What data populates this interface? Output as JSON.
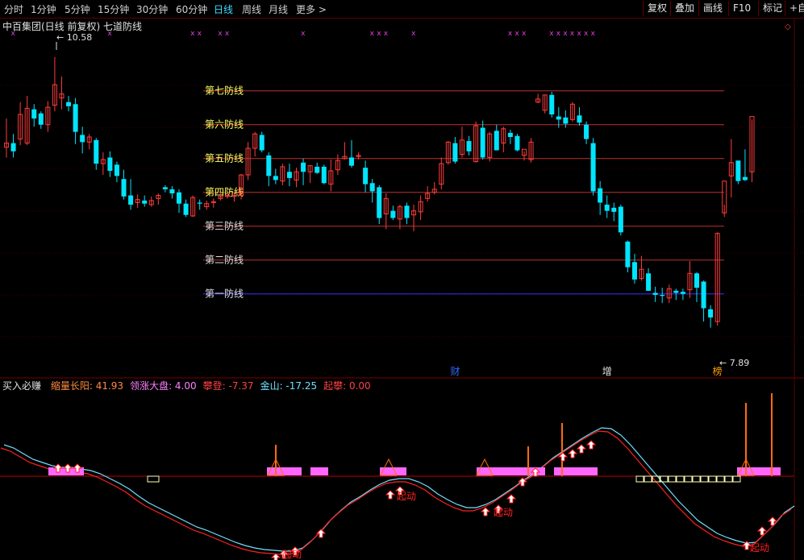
{
  "toolbar": {
    "periods": [
      "分时",
      "1分钟",
      "5分钟",
      "15分钟",
      "30分钟",
      "60分钟",
      "日线",
      "周线",
      "月线",
      "更多 >"
    ],
    "active_period": "日线",
    "right_buttons": [
      "复权",
      "叠加",
      "画线",
      "F10",
      "标记",
      "+自"
    ]
  },
  "main": {
    "title": "中百集团(日线 前复权) 七道防线",
    "high_label": "10.58",
    "low_label": "7.89",
    "defense_lines": [
      {
        "label": "第七防线",
        "price": 10.25
      },
      {
        "label": "第六防线",
        "price": 9.92
      },
      {
        "label": "第五防线",
        "price": 9.59
      },
      {
        "label": "第四防线",
        "price": 9.26
      },
      {
        "label": "第三防线",
        "price": 8.93
      },
      {
        "label": "第二防线",
        "price": 8.6
      },
      {
        "label": "第一防线",
        "price": 8.27
      }
    ],
    "events": [
      {
        "text": "财",
        "index": 65,
        "color": "#2a6cff"
      },
      {
        "text": "增",
        "index": 87,
        "color": "#e0e0e0"
      },
      {
        "text": "榜",
        "index": 103,
        "color": "#ffa000"
      }
    ],
    "colors": {
      "up": "#ff3c3c",
      "down": "#00e5ff",
      "line": "#c03030",
      "first_line": "#3030ff",
      "label": "#ffff60"
    }
  },
  "chart_data": {
    "type": "candlestick",
    "y_range": [
      7.6,
      10.9
    ],
    "candles": [
      [
        9.7,
        9.98,
        9.6,
        9.74
      ],
      [
        9.74,
        9.83,
        9.6,
        9.66
      ],
      [
        9.78,
        10.14,
        9.72,
        10.02
      ],
      [
        9.74,
        10.2,
        9.72,
        10.08
      ],
      [
        10.07,
        10.12,
        9.9,
        9.98
      ],
      [
        10.03,
        10.05,
        9.88,
        9.92
      ],
      [
        9.92,
        10.15,
        9.85,
        10.09
      ],
      [
        10.11,
        10.58,
        10.05,
        10.31
      ],
      [
        10.18,
        10.39,
        10.07,
        10.22
      ],
      [
        10.14,
        10.2,
        10.05,
        10.1
      ],
      [
        10.12,
        10.18,
        9.73,
        9.85
      ],
      [
        9.82,
        9.9,
        9.64,
        9.75
      ],
      [
        9.75,
        9.83,
        9.68,
        9.8
      ],
      [
        9.77,
        9.79,
        9.48,
        9.54
      ],
      [
        9.54,
        9.65,
        9.43,
        9.58
      ],
      [
        9.6,
        9.66,
        9.41,
        9.47
      ],
      [
        9.53,
        9.56,
        9.36,
        9.42
      ],
      [
        9.39,
        9.48,
        9.19,
        9.22
      ],
      [
        9.23,
        9.39,
        9.09,
        9.14
      ],
      [
        9.16,
        9.24,
        9.11,
        9.19
      ],
      [
        9.18,
        9.23,
        9.12,
        9.15
      ],
      [
        9.14,
        9.22,
        9.12,
        9.18
      ],
      [
        9.2,
        9.25,
        9.14,
        9.23
      ],
      [
        9.31,
        9.33,
        9.26,
        9.29
      ],
      [
        9.29,
        9.32,
        9.2,
        9.25
      ],
      [
        9.26,
        9.29,
        9.06,
        9.15
      ],
      [
        9.15,
        9.19,
        9.02,
        9.04
      ],
      [
        9.03,
        9.23,
        9.02,
        9.21
      ],
      [
        9.16,
        9.19,
        9.09,
        9.15
      ],
      [
        9.12,
        9.18,
        9.09,
        9.15
      ],
      [
        9.16,
        9.2,
        9.11,
        9.17
      ],
      [
        9.2,
        9.25,
        9.18,
        9.22
      ],
      [
        9.22,
        9.24,
        9.2,
        9.23
      ],
      [
        9.22,
        9.26,
        9.17,
        9.23
      ],
      [
        9.23,
        9.44,
        9.19,
        9.43
      ],
      [
        9.43,
        9.75,
        9.38,
        9.69
      ],
      [
        9.69,
        9.85,
        9.61,
        9.83
      ],
      [
        9.82,
        9.85,
        9.65,
        9.67
      ],
      [
        9.62,
        9.65,
        9.32,
        9.42
      ],
      [
        9.42,
        9.49,
        9.34,
        9.38
      ],
      [
        9.37,
        9.54,
        9.33,
        9.51
      ],
      [
        9.46,
        9.54,
        9.32,
        9.4
      ],
      [
        9.38,
        9.5,
        9.31,
        9.46
      ],
      [
        9.55,
        9.59,
        9.33,
        9.46
      ],
      [
        9.46,
        9.52,
        9.35,
        9.52
      ],
      [
        9.51,
        9.55,
        9.44,
        9.45
      ],
      [
        9.51,
        9.53,
        9.34,
        9.35
      ],
      [
        9.34,
        9.58,
        9.27,
        9.47
      ],
      [
        9.48,
        9.63,
        9.43,
        9.57
      ],
      [
        9.59,
        9.75,
        9.58,
        9.61
      ],
      [
        9.6,
        9.77,
        9.5,
        9.52
      ],
      [
        9.61,
        9.65,
        9.58,
        9.62
      ],
      [
        9.5,
        9.57,
        9.26,
        9.34
      ],
      [
        9.35,
        9.39,
        9.16,
        9.27
      ],
      [
        9.31,
        9.33,
        8.95,
        9.01
      ],
      [
        9.05,
        9.25,
        8.9,
        9.2
      ],
      [
        9.08,
        9.13,
        8.99,
        9.01
      ],
      [
        9.0,
        9.14,
        8.9,
        9.12
      ],
      [
        9.13,
        9.16,
        8.95,
        9.01
      ],
      [
        9.04,
        9.14,
        8.88,
        9.08
      ],
      [
        9.07,
        9.23,
        8.99,
        9.17
      ],
      [
        9.2,
        9.32,
        9.17,
        9.25
      ],
      [
        9.26,
        9.36,
        9.24,
        9.29
      ],
      [
        9.34,
        9.6,
        9.29,
        9.54
      ],
      [
        9.55,
        9.76,
        9.53,
        9.75
      ],
      [
        9.74,
        9.8,
        9.54,
        9.56
      ],
      [
        9.63,
        9.9,
        9.6,
        9.77
      ],
      [
        9.76,
        9.81,
        9.62,
        9.66
      ],
      [
        9.56,
        9.95,
        9.55,
        9.91
      ],
      [
        9.89,
        9.96,
        9.58,
        9.6
      ],
      [
        9.6,
        9.85,
        9.56,
        9.83
      ],
      [
        9.86,
        9.92,
        9.67,
        9.67
      ],
      [
        9.74,
        9.9,
        9.65,
        9.88
      ],
      [
        9.84,
        9.87,
        9.73,
        9.8
      ],
      [
        9.81,
        9.83,
        9.66,
        9.67
      ],
      [
        9.62,
        9.66,
        9.57,
        9.68
      ],
      [
        9.58,
        9.79,
        9.55,
        9.75
      ],
      [
        10.14,
        10.22,
        10.13,
        10.17
      ],
      [
        10.06,
        10.21,
        10.03,
        10.21
      ],
      [
        10.21,
        10.24,
        9.99,
        10.02
      ],
      [
        10.0,
        10.09,
        9.89,
        9.97
      ],
      [
        9.99,
        10.06,
        9.89,
        9.93
      ],
      [
        9.97,
        10.14,
        9.95,
        10.12
      ],
      [
        10.01,
        10.09,
        9.91,
        9.94
      ],
      [
        9.92,
        9.95,
        9.73,
        9.78
      ],
      [
        9.74,
        9.79,
        9.23,
        9.27
      ],
      [
        9.3,
        9.37,
        9.04,
        9.16
      ],
      [
        9.14,
        9.23,
        9.01,
        9.08
      ],
      [
        9.11,
        9.16,
        8.98,
        9.07
      ],
      [
        9.12,
        9.14,
        8.84,
        8.87
      ],
      [
        8.78,
        8.79,
        8.48,
        8.53
      ],
      [
        8.58,
        8.66,
        8.37,
        8.41
      ],
      [
        8.42,
        8.64,
        8.4,
        8.51
      ],
      [
        8.47,
        8.52,
        8.3,
        8.3
      ],
      [
        8.28,
        8.34,
        8.19,
        8.26
      ],
      [
        8.26,
        8.33,
        8.18,
        8.25
      ],
      [
        8.23,
        8.36,
        8.18,
        8.32
      ],
      [
        8.3,
        8.32,
        8.21,
        8.28
      ],
      [
        8.29,
        8.32,
        8.21,
        8.27
      ],
      [
        8.31,
        8.59,
        8.23,
        8.47
      ],
      [
        8.47,
        8.48,
        8.19,
        8.33
      ],
      [
        8.39,
        8.4,
        8.0,
        8.13
      ],
      [
        8.12,
        8.16,
        7.94,
        8.04
      ],
      [
        8.0,
        8.87,
        7.96,
        8.86
      ],
      [
        9.06,
        9.14,
        9.02,
        9.37
      ],
      [
        9.42,
        9.78,
        9.21,
        9.55
      ],
      [
        9.57,
        9.55,
        9.34,
        9.37
      ],
      [
        9.41,
        9.68,
        9.37,
        9.38
      ],
      [
        9.46,
        9.97,
        9.36,
        10.0
      ]
    ],
    "top_markers_index": [
      1,
      15,
      27,
      28,
      31,
      32,
      43,
      53,
      54,
      55,
      59,
      73,
      74,
      75,
      79,
      80,
      81,
      82,
      83,
      84,
      85
    ]
  },
  "indicator": {
    "name": "买入必赚",
    "readings": [
      {
        "label": "缩量长阳",
        "value": "41.93",
        "color": "#ff8a3c"
      },
      {
        "label": "领涨大盘",
        "value": "4.00",
        "color": "#ff80ff"
      },
      {
        "label": "攀登",
        "value": "-7.37",
        "color": "#ff4040"
      },
      {
        "label": "金山",
        "value": "-17.25",
        "color": "#6fe0ff"
      },
      {
        "label": "起攀",
        "value": "0.00",
        "color": "#ff4040"
      }
    ],
    "qidong_label": "起动",
    "colors": {
      "red": "#ff2020",
      "cyan": "#6fe0ff",
      "pink": "#ff66ff",
      "orange": "#ff6a10",
      "pale": "#ffffb0"
    }
  }
}
